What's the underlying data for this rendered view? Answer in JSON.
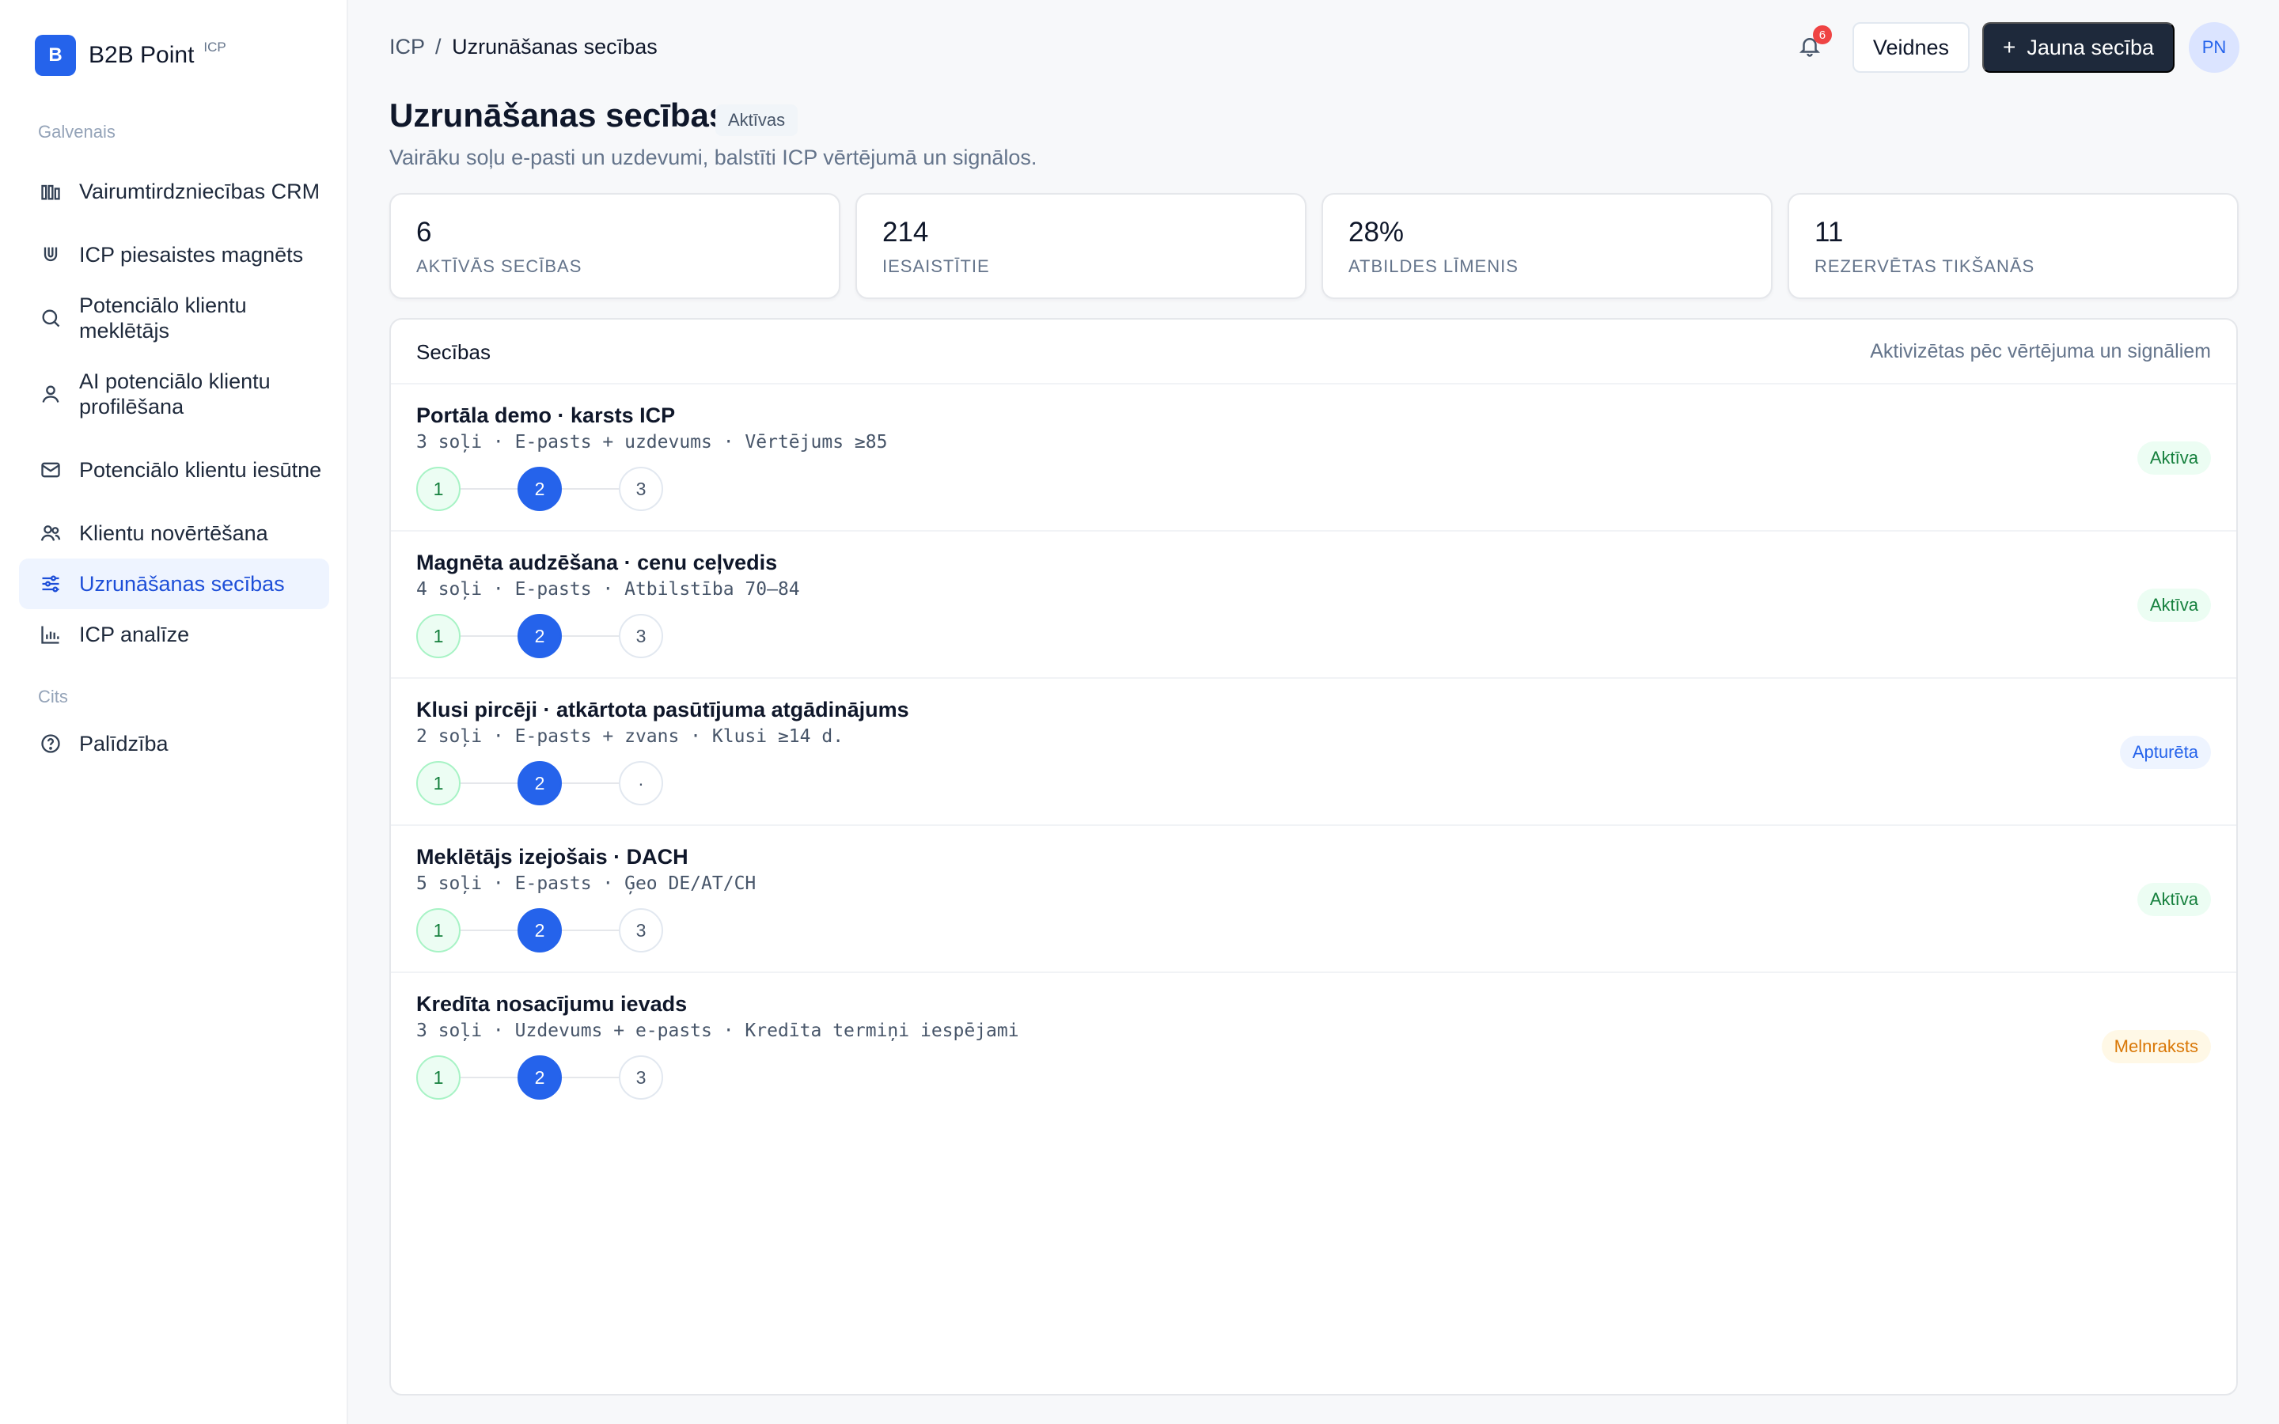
{
  "brand": {
    "logo_letter": "B",
    "name": "B2B Point",
    "tag": "ICP"
  },
  "sidebar": {
    "sections": [
      {
        "label": "Galvenais"
      },
      {
        "label": "Cits"
      }
    ],
    "items": [
      {
        "label": "Vairumtirdzniecības CRM",
        "icon": "bar-chart-icon"
      },
      {
        "label": "ICP piesaistes magnēts",
        "icon": "magnet-icon"
      },
      {
        "label": "Potenciālo klientu meklētājs",
        "icon": "search-icon"
      },
      {
        "label": "AI potenciālo klientu profilēšana",
        "icon": "user-icon"
      },
      {
        "label": "Potenciālo klientu iesūtne",
        "icon": "mail-icon"
      },
      {
        "label": "Klientu novērtēšana",
        "icon": "users-icon"
      },
      {
        "label": "Uzrunāšanas secības",
        "icon": "sliders-icon",
        "active": true
      },
      {
        "label": "ICP analīze",
        "icon": "chart-icon"
      },
      {
        "label": "Palīdzība",
        "icon": "help-icon"
      }
    ]
  },
  "header": {
    "breadcrumb_root": "ICP",
    "breadcrumb_sep": "/",
    "breadcrumb_current": "Uzrunāšanas secības",
    "notifications_count": "6",
    "templates_label": "Veidnes",
    "new_sequence_plus": "+",
    "new_sequence_label": "Jauna secība",
    "avatar_initials": "PN"
  },
  "page": {
    "title": "Uzrunāšanas secības",
    "status": "Aktīvas",
    "subtitle": "Vairāku soļu e-pasti un uzdevumi, balstīti ICP vērtējumā un signālos."
  },
  "stats": [
    {
      "value": "6",
      "label": "AKTĪVĀS SECĪBAS"
    },
    {
      "value": "214",
      "label": "IESAISTĪTIE"
    },
    {
      "value": "28%",
      "label": "ATBILDES LĪMENIS"
    },
    {
      "value": "11",
      "label": "REZERVĒTAS TIKŠANĀS"
    }
  ],
  "sequences_panel": {
    "title": "Secības",
    "note": "Aktivizētas pēc vērtējuma un signāliem",
    "rows": [
      {
        "name": "Portāla demo · karsts ICP",
        "meta": "3 soļi · E-pasts + uzdevums · Vērtējums ≥85",
        "steps": [
          "1",
          "2",
          "3"
        ],
        "status": "Aktīva",
        "status_color": "#15803d"
      },
      {
        "name": "Magnēta audzēšana · cenu ceļvedis",
        "meta": "4 soļi · E-pasts · Atbilstība 70–84",
        "steps": [
          "1",
          "2",
          "3"
        ],
        "status": "Aktīva",
        "status_color": "#15803d"
      },
      {
        "name": "Klusi pircēji · atkārtota pasūtījuma atgādinājums",
        "meta": "2 soļi · E-pasts + zvans · Klusi ≥14 d.",
        "steps": [
          "1",
          "2",
          "·"
        ],
        "status": "Apturēta",
        "status_color": "#2563eb"
      },
      {
        "name": "Meklētājs izejošais · DACH",
        "meta": "5 soļi · E-pasts · Ģeo DE/AT/CH",
        "steps": [
          "1",
          "2",
          "3"
        ],
        "status": "Aktīva",
        "status_color": "#15803d"
      },
      {
        "name": "Kredīta nosacījumu ievads",
        "meta": "3 soļi · Uzdevums + e-pasts · Kredīta termiņi iespējami",
        "steps": [
          "1",
          "2",
          "3"
        ],
        "status": "Melnraksts",
        "status_color": "#d97706"
      }
    ]
  }
}
